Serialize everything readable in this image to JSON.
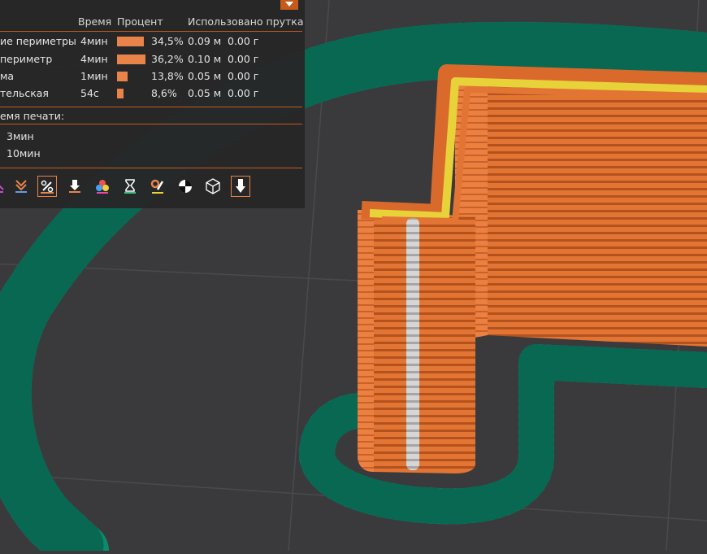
{
  "legend": {
    "columns": {
      "time": "Время",
      "percent": "Процент",
      "filament": "Использовано прутка"
    },
    "rows": [
      {
        "name": "ие периметры",
        "time": "4мин",
        "percent": "34,5%",
        "fill": 0.345,
        "length": "0.09 м",
        "weight": "0.00 г"
      },
      {
        "name": "периметр",
        "time": "4мин",
        "percent": "36,2%",
        "fill": 0.362,
        "length": "0.10 м",
        "weight": "0.00 г"
      },
      {
        "name": "ма",
        "time": "1мин",
        "percent": "13,8%",
        "fill": 0.138,
        "length": "0.05 м",
        "weight": "0.00 г"
      },
      {
        "name": "тельская",
        "time": "54с",
        "percent": "8,6%",
        "fill": 0.086,
        "length": "0.05 м",
        "weight": "0.00 г"
      }
    ],
    "print_time_label": "емя печати:",
    "time_values": [
      "3мин",
      "10мин"
    ]
  },
  "toolbar": {
    "tools": [
      "travel-icon",
      "layer-arrows-icon",
      "seams-icon",
      "tool-change-icon",
      "color-change-icon",
      "pause-icon",
      "custom-gcode-icon",
      "center-of-gravity-icon",
      "shells-icon",
      "tool-marker-icon"
    ]
  },
  "colors": {
    "accent": "#e8844a",
    "perimeter": "#e07232",
    "skirt": "#0c8a6c",
    "top": "#e8d23a",
    "seam": "#d4d4d4",
    "background": "#3a3a3d",
    "panel": "#262628"
  }
}
